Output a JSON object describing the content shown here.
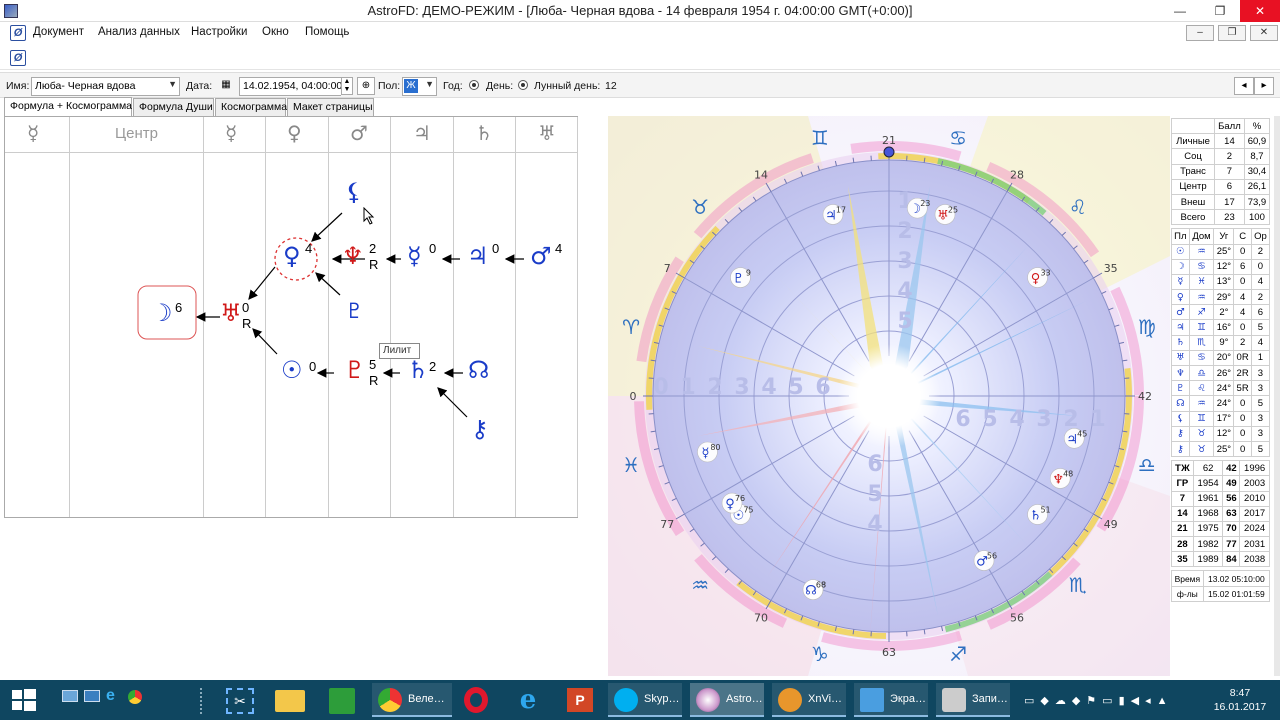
{
  "window": {
    "title": "AstroFD: ДЕМО-РЕЖИМ - [Люба- Черная вдова - 14 февраля 1954 г. 04:00:00 GMT(+0:00)]",
    "min": "—",
    "max": "❐",
    "close": "✕"
  },
  "menu": [
    "Документ",
    "Анализ данных",
    "Настройки",
    "Окно",
    "Помощь"
  ],
  "mdi": {
    "min": "–",
    "restore": "❐",
    "close": "✕"
  },
  "info": {
    "name_label": "Имя:",
    "name_value": "Люба- Черная вдова",
    "date_label": "Дата:",
    "date_value": "14.02.1954, 04:00:00",
    "sex_label": "Пол:",
    "sex_value": "Ж",
    "year_label": "Год:",
    "day_label": "День:",
    "lunar_label": "Лунный день:",
    "lunar_value": "12"
  },
  "tabs": [
    "Формула + Космограмма",
    "Формула Души",
    "Космограмма",
    "Макет страницы"
  ],
  "formula": {
    "headers": [
      "☿",
      "Центр",
      "☿",
      "♀",
      "♂",
      "♃",
      "♄",
      "♅"
    ],
    "tooltip": "Лилит",
    "lilith": "⚸",
    "venus": "♀",
    "venus_n": "4",
    "neptune": "♆",
    "neptune_n": "2",
    "neptune_r": "R",
    "mercury": "☿",
    "mercury_n": "0",
    "jupiter": "♃",
    "jupiter_n": "0",
    "mars": "♂",
    "mars_n": "4",
    "pluto_small": "♇",
    "moon": "☽",
    "moon_n": "6",
    "uranus": "♅",
    "uranus_n": "0",
    "uranus_r": "R",
    "sun": "☉",
    "sun_n": "0",
    "pluto": "♇",
    "pluto_n": "5",
    "pluto_r": "R",
    "saturn": "♄",
    "saturn_n": "2",
    "node": "☊",
    "chiron": "⚷"
  },
  "chart": {
    "degree_labels": {
      "top": "63",
      "right": "42",
      "bottom": "21",
      "left": "0",
      "d56": "56",
      "d49": "49",
      "d35": "35",
      "d28": "28",
      "d14": "14",
      "d7": "7",
      "d70": "70",
      "d77": "77"
    },
    "signs": {
      "cap": "♑",
      "sag": "♐",
      "aqu": "♒",
      "sco": "♏",
      "pis": "♓",
      "lib": "♎",
      "ari": "♈",
      "vir": "♍",
      "tau": "♉",
      "leo": "♌",
      "gem": "♊",
      "can": "♋"
    },
    "planets": [
      {
        "g": "♅",
        "n": "68"
      },
      {
        "g": "☊",
        "n": "68"
      },
      {
        "g": "☉",
        "n": "75"
      },
      {
        "g": "♂",
        "n": "56"
      },
      {
        "g": "♄",
        "n": "51"
      },
      {
        "g": "☿",
        "n": "80"
      },
      {
        "g": "♀",
        "n": "76"
      },
      {
        "g": "♆",
        "n": "48"
      },
      {
        "g": "♃",
        "n": "45"
      },
      {
        "g": "♀",
        "n": "33"
      },
      {
        "g": "☽",
        "n": "23"
      },
      {
        "g": "♇",
        "n": "9"
      },
      {
        "g": "♃",
        "n": "17"
      },
      {
        "g": "♅",
        "n": "25"
      }
    ],
    "inner_nums_top": [
      "1",
      "2",
      "3",
      "4",
      "5"
    ],
    "inner_nums_left": [
      "0",
      "1",
      "2",
      "3",
      "4",
      "5",
      "6"
    ],
    "inner_nums_right": [
      "6",
      "5",
      "4",
      "3",
      "2",
      "1"
    ],
    "inner_nums_bottom": [
      "6",
      "5",
      "4"
    ]
  },
  "stats": {
    "head": [
      "",
      "Балл",
      "%"
    ],
    "rows": [
      [
        "Личные",
        "14",
        "60,9"
      ],
      [
        "Соц",
        "2",
        "8,7"
      ],
      [
        "Транс",
        "7",
        "30,4"
      ],
      [
        "Центр",
        "6",
        "26,1"
      ],
      [
        "Внеш",
        "17",
        "73,9"
      ],
      [
        "Всего",
        "23",
        "100"
      ]
    ],
    "phead": [
      "Пл",
      "Дом",
      "Уг",
      "С",
      "Ор"
    ],
    "prows": [
      [
        "☉",
        "♒",
        "25°",
        "0",
        "2"
      ],
      [
        "☽",
        "♋",
        "12°",
        "6",
        "0"
      ],
      [
        "☿",
        "♓",
        "13°",
        "0",
        "4"
      ],
      [
        "♀",
        "♒",
        "29°",
        "4",
        "2"
      ],
      [
        "♂",
        "♐",
        "2°",
        "4",
        "6"
      ],
      [
        "♃",
        "♊",
        "16°",
        "0",
        "5"
      ],
      [
        "♄",
        "♏",
        "9°",
        "2",
        "4"
      ],
      [
        "♅",
        "♋",
        "20°",
        "0R",
        "1"
      ],
      [
        "♆",
        "♎",
        "26°",
        "2R",
        "3"
      ],
      [
        "♇",
        "♌",
        "24°",
        "5R",
        "3"
      ],
      [
        "☊",
        "♒",
        "24°",
        "0",
        "5"
      ],
      [
        "⚸",
        "♊",
        "17°",
        "0",
        "3"
      ],
      [
        "⚷",
        "♉",
        "12°",
        "0",
        "3"
      ],
      [
        "⚷",
        "♉",
        "25°",
        "0",
        "5"
      ]
    ],
    "years": [
      [
        "ТЖ",
        "62",
        "42",
        "1996"
      ],
      [
        "ГР",
        "1954",
        "49",
        "2003"
      ],
      [
        "7",
        "1961",
        "56",
        "2010"
      ],
      [
        "14",
        "1968",
        "63",
        "2017"
      ],
      [
        "21",
        "1975",
        "70",
        "2024"
      ],
      [
        "28",
        "1982",
        "77",
        "2031"
      ],
      [
        "35",
        "1989",
        "84",
        "2038"
      ]
    ],
    "time": [
      [
        "Время",
        "13.02 05:10:00"
      ],
      [
        "ф-лы",
        "15.02 01:01:59"
      ]
    ]
  },
  "taskbar": {
    "chrome": "Веле…",
    "skype": "Skyp…",
    "astro": "Astro…",
    "xnview": "XnVi…",
    "ekran": "Экра…",
    "zapis": "Запи…",
    "time": "8:47",
    "date": "16.01.2017"
  }
}
